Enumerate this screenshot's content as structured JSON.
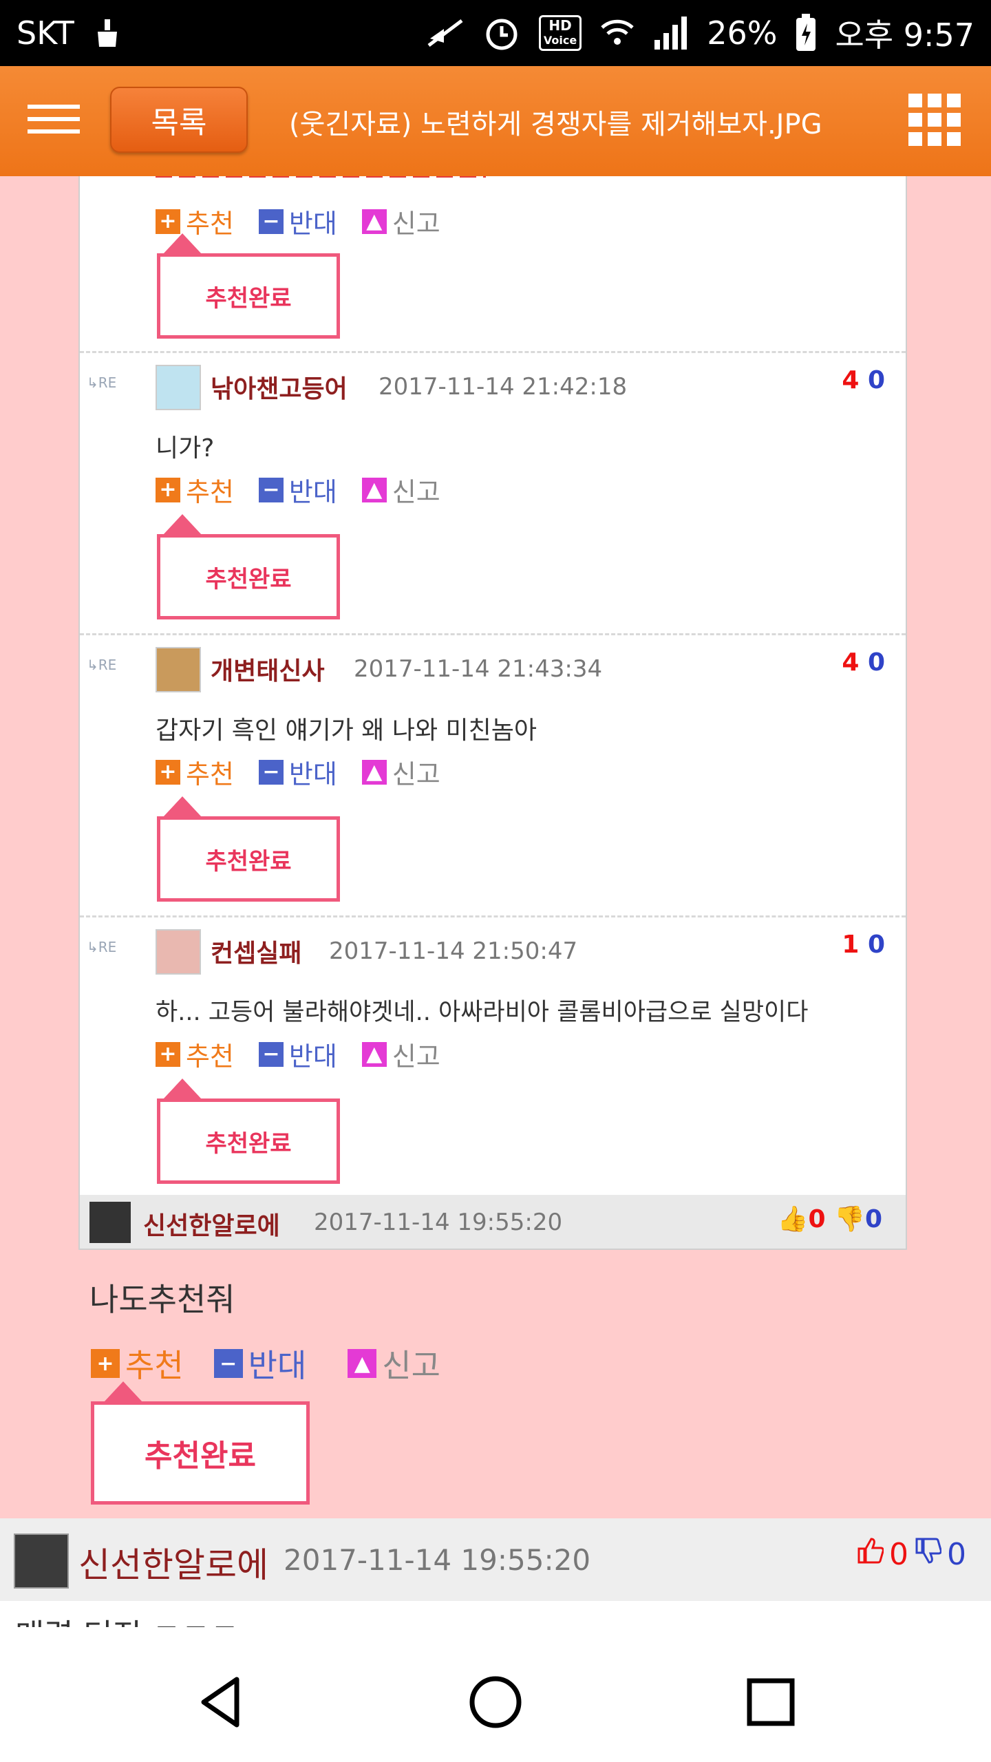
{
  "status_bar": {
    "carrier": "SKT",
    "hd_top": "HD",
    "hd_bottom": "Voice",
    "battery_percent": "26%",
    "time": "오후 9:57"
  },
  "header": {
    "list_button": "목록",
    "title": "(웃긴자료) 노련하게 경쟁자를 제거해보자.JPG"
  },
  "actions": {
    "recommend": "추천",
    "oppose": "반대",
    "report": "신고",
    "recommend_done": "추천완료"
  },
  "embedded_image": {
    "re_label": "RE",
    "comments": [
      {
        "user": "낚아챈고등어",
        "time": "2017-11-14 21:42:18",
        "up": "4",
        "down": "0",
        "text": "니가?"
      },
      {
        "user": "개변태신사",
        "time": "2017-11-14 21:43:34",
        "up": "4",
        "down": "0",
        "text": "갑자기 흑인 얘기가 왜 나와 미친놈아"
      },
      {
        "user": "컨셉실패",
        "time": "2017-11-14 21:50:47",
        "up": "1",
        "down": "0",
        "text": "하... 고등어 불라해야겟네.. 아싸라비아 콜롬비아급으로 실망이다"
      }
    ],
    "footer": {
      "user": "신선한알로에",
      "time": "2017-11-14 19:55:20",
      "up": "0",
      "down": "0"
    }
  },
  "post_text": "나도추천줘",
  "comment": {
    "user": "신선한알로에",
    "time": "2017-11-14 19:55:20",
    "up": "0",
    "down": "0",
    "next_text_partial": "매력 터진 ㅋㅋㅋ"
  },
  "colors": {
    "header_orange": "#ee7418",
    "page_pink": "#ffcccc",
    "recommend_orange": "#f07a1a",
    "oppose_blue": "#4b63c9",
    "done_pink": "#f0597d",
    "username_red": "#8e1f1f"
  },
  "icons": [
    "no-sound-icon",
    "alarm-icon",
    "wifi-icon",
    "signal-icon",
    "battery-icon",
    "menu-icon",
    "grid-icon",
    "thumb-up-icon",
    "thumb-down-icon",
    "back-icon",
    "home-icon",
    "recents-icon"
  ]
}
